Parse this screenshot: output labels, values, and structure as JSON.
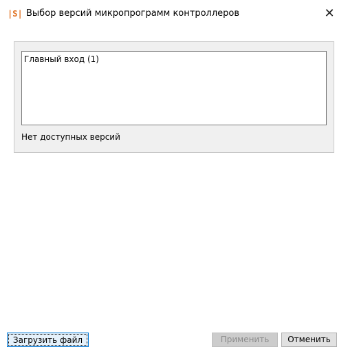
{
  "window": {
    "icon_text": "|S|",
    "title": "Выбор версий микропрограмм контроллеров",
    "close_glyph": "✕"
  },
  "controllers": {
    "items": [
      {
        "label": "Главный вход (1)"
      }
    ],
    "status_text": "Нет доступных версий"
  },
  "buttons": {
    "load_file": "Загрузить файл",
    "apply": "Применить",
    "apply_enabled": false,
    "cancel": "Отменить"
  },
  "colors": {
    "icon_accent": "#e07020",
    "focus_border": "#0078d7",
    "panel_background": "#f0f0f0"
  }
}
